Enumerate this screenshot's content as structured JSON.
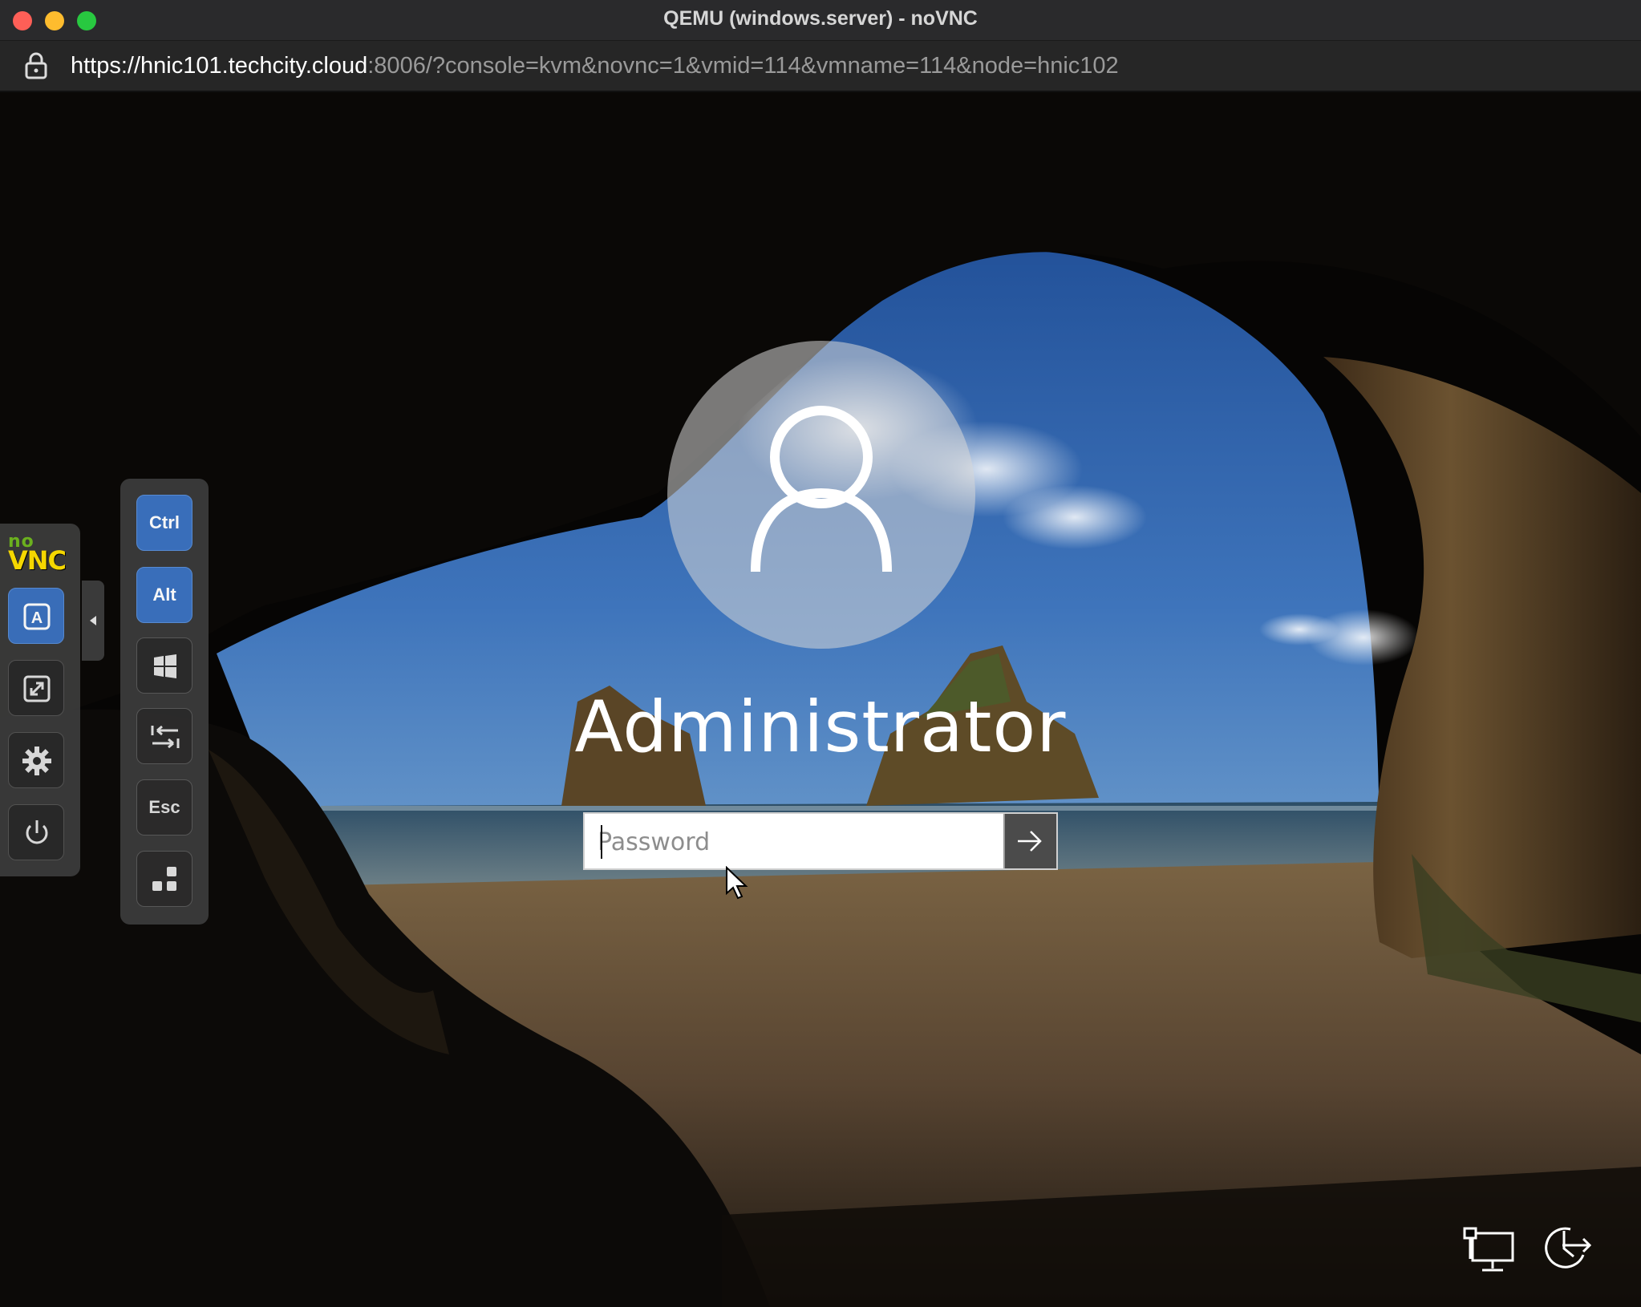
{
  "window": {
    "title": "QEMU (windows.server) - noVNC"
  },
  "address_bar": {
    "scheme": "https://",
    "host": "hnic101.techcity.cloud",
    "rest": ":8006/?console=kvm&novnc=1&vmid=114&vmname=114&node=hnic102"
  },
  "login": {
    "username": "Administrator",
    "password_placeholder": "Password"
  },
  "novnc": {
    "logo_top": "no",
    "logo_bottom": "VNC",
    "buttons": [
      "keyboard-icon",
      "fullscreen-icon",
      "settings-gear-icon",
      "power-icon"
    ]
  },
  "extra_keys": {
    "ctrl": "Ctrl",
    "alt": "Alt",
    "esc": "Esc",
    "windows_icon": "windows-logo-icon",
    "tab_icon": "tab-icon",
    "ctrl_alt_del_icon": "ctrl-alt-del-icon"
  },
  "colors": {
    "accent_blue": "#3b72c0",
    "novnc_yellow": "#ffe000",
    "novnc_green": "#6fb71f"
  }
}
